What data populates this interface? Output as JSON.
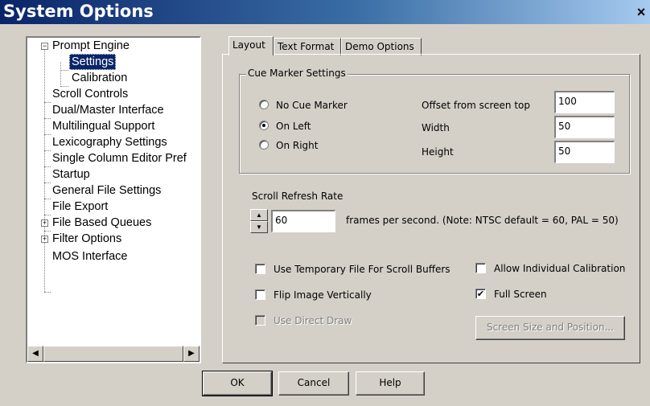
{
  "window": {
    "title": "System Options",
    "close_glyph": "×"
  },
  "tree": {
    "items": [
      {
        "label": "Prompt Engine",
        "expander": "−"
      },
      {
        "label": "Settings",
        "selected": true
      },
      {
        "label": "Calibration"
      },
      {
        "label": "Scroll Controls"
      },
      {
        "label": "Dual/Master Interface"
      },
      {
        "label": "Multilingual Support"
      },
      {
        "label": "Lexicography Settings"
      },
      {
        "label": "Single Column Editor Pref"
      },
      {
        "label": "Startup"
      },
      {
        "label": "General File Settings"
      },
      {
        "label": "File Export"
      },
      {
        "label": "File Based Queues",
        "expander": "+"
      },
      {
        "label": "Filter Options",
        "expander": "+"
      },
      {
        "label": "MOS Interface"
      }
    ],
    "scroll_left_glyph": "◀",
    "scroll_right_glyph": "▶"
  },
  "tabs": [
    {
      "label": "Layout",
      "active": true
    },
    {
      "label": "Text Format"
    },
    {
      "label": "Demo Options"
    }
  ],
  "cue_marker": {
    "group_label": "Cue Marker Settings",
    "options": [
      "No Cue Marker",
      "On Left",
      "On Right"
    ],
    "selected": "On Left",
    "offset_label": "Offset from screen top",
    "offset_value": "100",
    "width_label": "Width",
    "width_value": "50",
    "height_label": "Height",
    "height_value": "50"
  },
  "scroll_refresh": {
    "label": "Scroll Refresh Rate",
    "value": "60",
    "note": "frames per second. (Note: NTSC default = 60, PAL = 50)",
    "up_glyph": "▲",
    "down_glyph": "▼"
  },
  "checkboxes": {
    "use_temp_file": {
      "label": "Use Temporary File For Scroll Buffers",
      "checked": false
    },
    "allow_individual_calibration": {
      "label": "Allow Individual Calibration",
      "checked": false
    },
    "flip_image": {
      "label": "Flip Image Vertically",
      "checked": false
    },
    "full_screen": {
      "label": "Full Screen",
      "checked": true,
      "check_glyph": "✔"
    },
    "use_direct_draw": {
      "label": "Use Direct Draw",
      "checked": false,
      "disabled": true
    }
  },
  "buttons": {
    "screen_size": "Screen Size and Position...",
    "ok": "OK",
    "cancel": "Cancel",
    "help": "Help"
  }
}
